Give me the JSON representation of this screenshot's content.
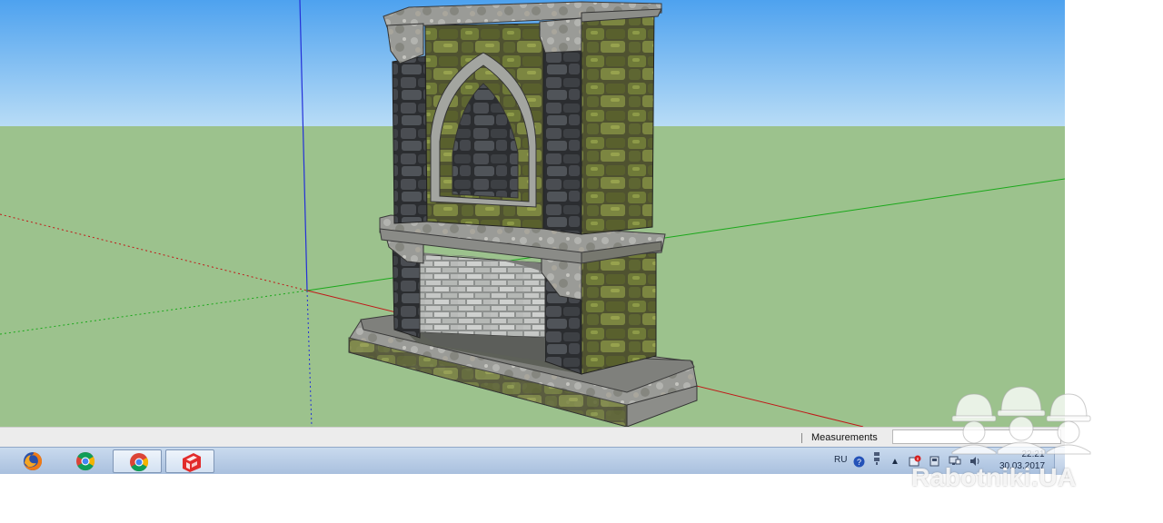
{
  "viewport": {
    "sky_color": "#56a8f0",
    "ground_color": "#9cc28d",
    "model": "stone-fireplace"
  },
  "statusbar": {
    "measurements_label": "Measurements",
    "measurements_value": ""
  },
  "taskbar": {
    "apps": [
      {
        "icon": "firefox-icon",
        "active": false
      },
      {
        "icon": "chrome-icon",
        "active": false
      },
      {
        "icon": "chrome-icon",
        "active": true
      },
      {
        "icon": "sketchup-icon",
        "active": true
      }
    ],
    "tray": {
      "language": "RU",
      "time": "22:21",
      "date": "30.03.2017"
    }
  },
  "watermark": {
    "text": "Rabotniki.UA"
  }
}
